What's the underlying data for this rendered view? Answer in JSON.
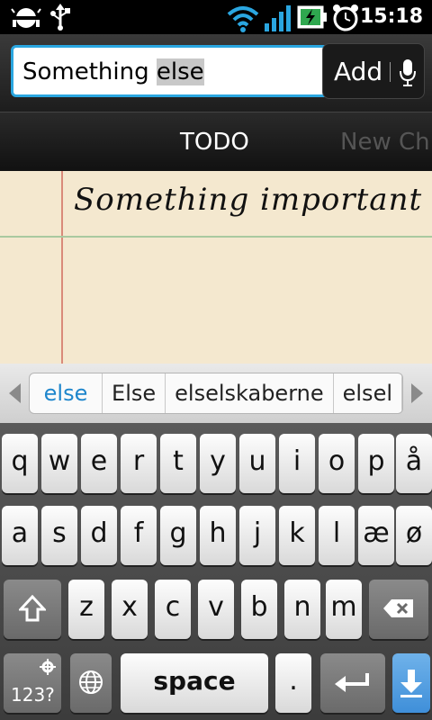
{
  "status_bar": {
    "time": "15:18",
    "icons": [
      "android-debug-icon",
      "usb-icon",
      "wifi-icon",
      "signal-icon",
      "battery-charging-icon",
      "alarm-icon"
    ]
  },
  "input": {
    "value_plain": "Something ",
    "value_selected": "else",
    "add_label": "Add"
  },
  "tabs": [
    {
      "label": "TODO"
    },
    {
      "label": "New Ch"
    }
  ],
  "todo_items": [
    {
      "text": "Something important"
    }
  ],
  "suggestions": [
    "else",
    "Else",
    "elselskaberne",
    "elsel"
  ],
  "keyboard": {
    "row1": [
      "q",
      "w",
      "e",
      "r",
      "t",
      "y",
      "u",
      "i",
      "o",
      "p",
      "å"
    ],
    "row2": [
      "a",
      "s",
      "d",
      "f",
      "g",
      "h",
      "j",
      "k",
      "l",
      "æ",
      "ø"
    ],
    "row3": [
      "z",
      "x",
      "c",
      "v",
      "b",
      "n",
      "m"
    ],
    "bottom": {
      "symbols": "123?",
      "space": "space",
      "period": "."
    }
  },
  "colors": {
    "accent": "#2aa6e0",
    "suggestion_highlight": "#1e86cc",
    "paper": "#f4e8cf"
  }
}
